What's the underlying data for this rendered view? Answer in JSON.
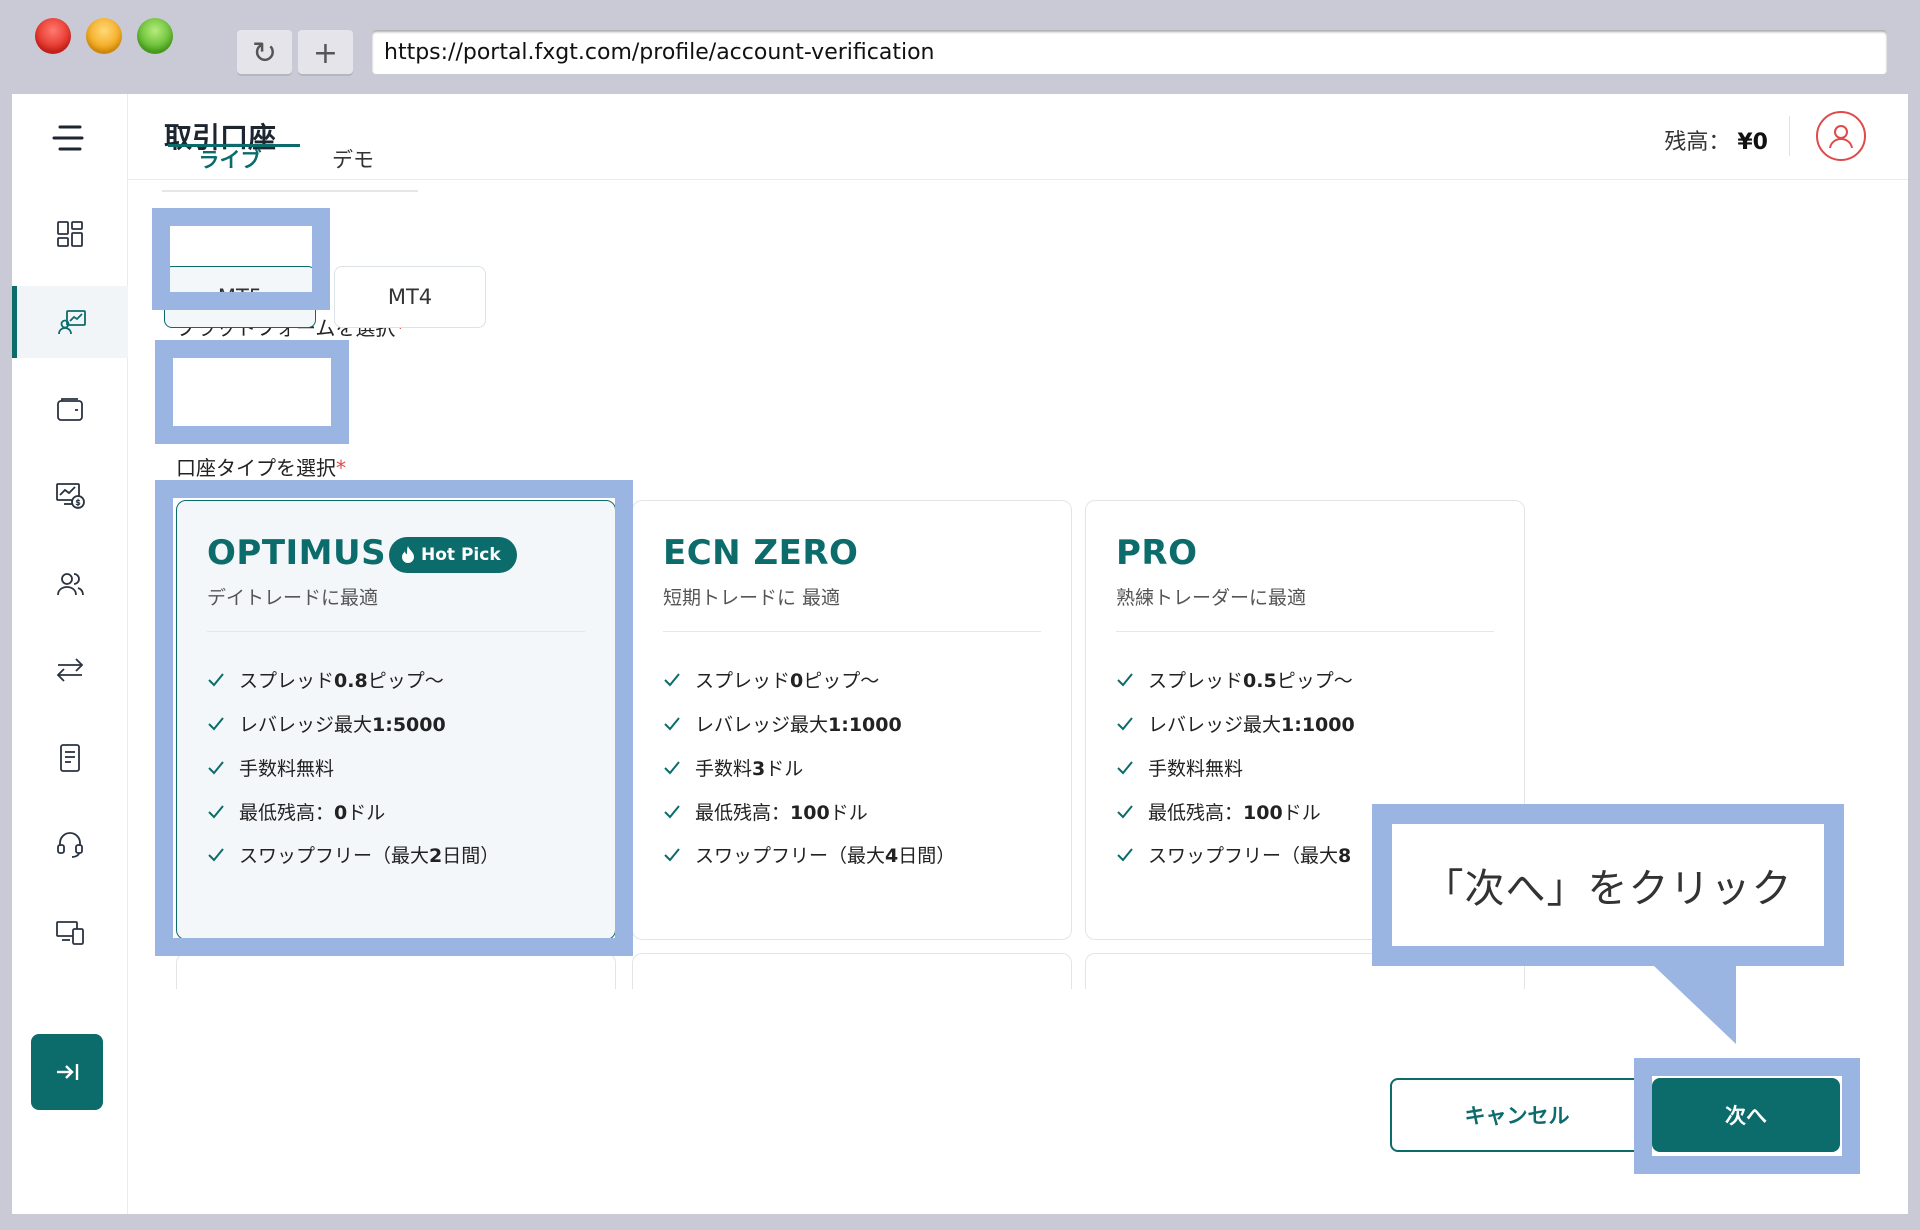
{
  "browser": {
    "url": "https://portal.fxgt.com/profile/account-verification",
    "reload_icon": "reload-icon",
    "newtab_icon": "plus-icon"
  },
  "header": {
    "title": "取引口座",
    "balance_label": "残高：",
    "balance_value": "¥0"
  },
  "sidebar": {
    "items": [
      {
        "icon": "dashboard-icon"
      },
      {
        "icon": "trading-account-icon",
        "active": true
      },
      {
        "icon": "wallet-icon"
      },
      {
        "icon": "monitor-dollar-icon"
      },
      {
        "icon": "users-icon"
      },
      {
        "icon": "transfer-icon"
      },
      {
        "icon": "document-icon"
      },
      {
        "icon": "support-headset-icon"
      },
      {
        "icon": "devices-icon"
      }
    ]
  },
  "tabs": {
    "live": "ライブ",
    "demo": "デモ"
  },
  "platform": {
    "label": "プラットフォームを選択",
    "required": "*",
    "options": [
      "MT5",
      "MT4"
    ],
    "selected": "MT5"
  },
  "account_type": {
    "label": "口座タイプを選択",
    "required": "*",
    "cards": [
      {
        "title": "OPTIMUS",
        "badge": "Hot Pick",
        "subtitle": "デイトレードに最適",
        "features": [
          {
            "pre": "スプレッド",
            "bold": "0.8",
            "post": "ピップ〜"
          },
          {
            "pre": "レバレッジ最大",
            "bold": "1:5000",
            "post": ""
          },
          {
            "pre": "手数料無料",
            "bold": "",
            "post": ""
          },
          {
            "pre": "最低残高：",
            "bold": "0",
            "post": "ドル"
          },
          {
            "pre": "スワップフリー（最大",
            "bold": "2",
            "post": "日間）"
          }
        ]
      },
      {
        "title": "ECN ZERO",
        "subtitle": "短期トレードに 最適",
        "features": [
          {
            "pre": "スプレッド",
            "bold": "0",
            "post": "ピップ〜"
          },
          {
            "pre": "レバレッジ最大",
            "bold": "1:1000",
            "post": ""
          },
          {
            "pre": "手数料",
            "bold": "3",
            "post": "ドル"
          },
          {
            "pre": "最低残高：",
            "bold": "100",
            "post": "ドル"
          },
          {
            "pre": "スワップフリー（最大",
            "bold": "4",
            "post": "日間）"
          }
        ]
      },
      {
        "title": "PRO",
        "subtitle": "熟練トレーダーに最適",
        "features": [
          {
            "pre": "スプレッド",
            "bold": "0.5",
            "post": "ピップ〜"
          },
          {
            "pre": "レバレッジ最大",
            "bold": "1:1000",
            "post": ""
          },
          {
            "pre": "手数料無料",
            "bold": "",
            "post": ""
          },
          {
            "pre": "最低残高：",
            "bold": "100",
            "post": "ドル"
          },
          {
            "pre": "スワップフリー（最大",
            "bold": "8",
            "post": ""
          }
        ]
      }
    ]
  },
  "footer": {
    "cancel": "キャンセル",
    "next": "次へ"
  },
  "callout": {
    "text": "「次へ」をクリック"
  },
  "colors": {
    "accent": "#0c6b6b",
    "highlight": "#9ab5e2",
    "required": "#e04a4a"
  }
}
